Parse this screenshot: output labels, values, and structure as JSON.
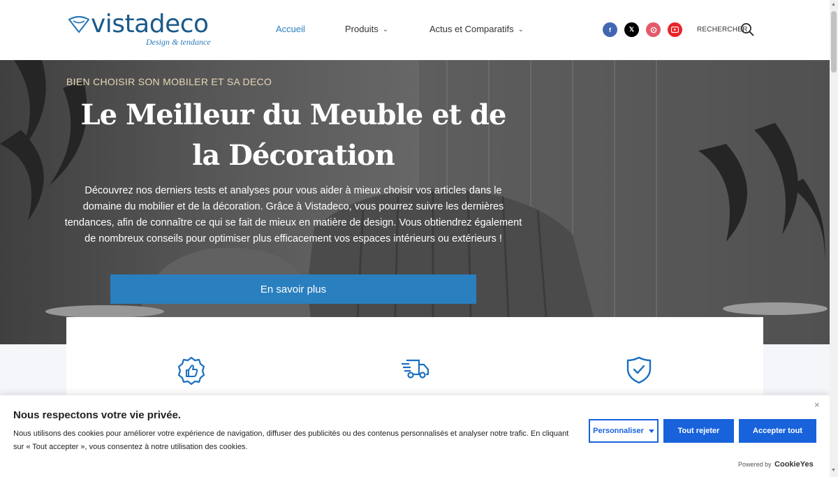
{
  "header": {
    "logo_name": "vistadeco",
    "logo_tagline": "Design & tendance",
    "nav": [
      {
        "label": "Accueil"
      },
      {
        "label": "Produits"
      },
      {
        "label": "Actus et Comparatifs"
      }
    ],
    "social_icons": [
      "facebook-icon",
      "x-icon",
      "pinterest-icon",
      "youtube-icon"
    ],
    "search_label": "RECHERCHER",
    "colors": {
      "brand": "#1b5a8c",
      "accent": "#2a7fbf",
      "facebook": "#4267b2",
      "x": "#000000",
      "pinterest": "#e35a6a",
      "youtube": "#e8242a"
    }
  },
  "hero": {
    "eyebrow": "BIEN CHOISIR SON MOBILER ET SA DECO",
    "title": "Le Meilleur du Meuble et de la Décoration",
    "description": "Découvrez nos derniers tests et analyses pour vous aider à mieux choisir vos articles dans le domaine du mobilier et de la décoration. Grâce à Vistadeco, vous pourrez suivre les dernières tendances, afin de connaître ce qui se fait de mieux en matière de design. Vous obtiendrez également de nombreux conseils pour optimiser plus efficacement vos espaces intérieurs ou extérieurs !",
    "cta_label": "En savoir plus"
  },
  "features": {
    "icons": [
      "thumbs-up-badge-icon",
      "delivery-truck-icon",
      "shield-check-icon"
    ]
  },
  "cookie_banner": {
    "title": "Nous respectons votre vie privée.",
    "text": "Nous utilisons des cookies pour améliorer votre expérience de navigation, diffuser des publicités ou des contenus personnalisés et analyser notre trafic. En cliquant sur « Tout accepter », vous consentez à notre utilisation des cookies.",
    "customize_label": "Personnaliser",
    "reject_label": "Tout rejeter",
    "accept_label": "Accepter tout",
    "close_symbol": "×",
    "powered_by": "Powered by",
    "powered_brand": "CookieYes",
    "colors": {
      "button": "#1863dc"
    }
  }
}
